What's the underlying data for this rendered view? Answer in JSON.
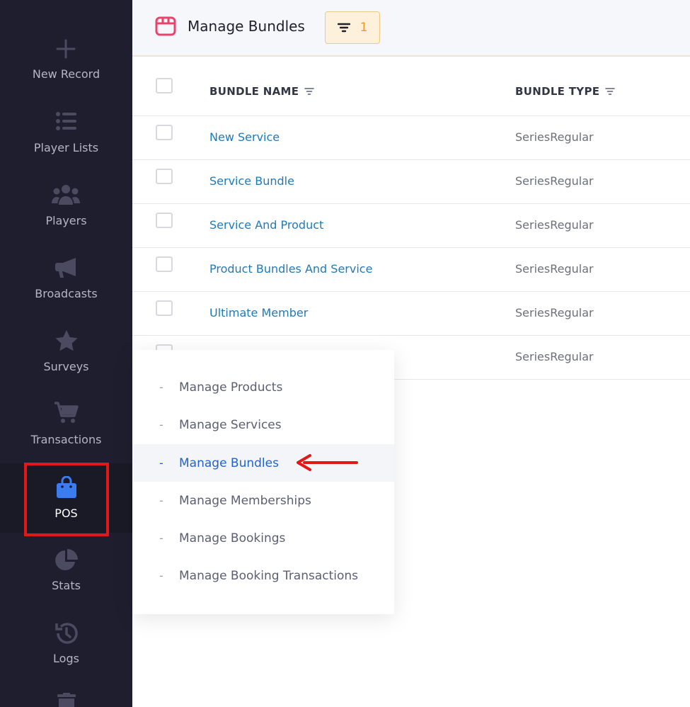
{
  "sidebar": {
    "items": [
      {
        "label": "New Record",
        "icon": "plus-icon"
      },
      {
        "label": "Player Lists",
        "icon": "list-icon"
      },
      {
        "label": "Players",
        "icon": "users-icon"
      },
      {
        "label": "Broadcasts",
        "icon": "megaphone-icon"
      },
      {
        "label": "Surveys",
        "icon": "star-icon"
      },
      {
        "label": "Transactions",
        "icon": "cart-icon"
      },
      {
        "label": "POS",
        "icon": "shopping-bag-icon",
        "active": true
      },
      {
        "label": "Stats",
        "icon": "pie-chart-icon"
      },
      {
        "label": "Logs",
        "icon": "history-icon"
      },
      {
        "label": "",
        "icon": "trash-icon"
      }
    ]
  },
  "header": {
    "title": "Manage Bundles",
    "title_icon": "bundle-box-icon",
    "filter_count": "1"
  },
  "table": {
    "columns": [
      "BUNDLE NAME",
      "BUNDLE TYPE"
    ],
    "rows": [
      {
        "name": "New Service",
        "type": "SeriesRegular"
      },
      {
        "name": "Service Bundle",
        "type": "SeriesRegular"
      },
      {
        "name": "Service And Product",
        "type": "SeriesRegular"
      },
      {
        "name": "Product Bundles And Service",
        "type": "SeriesRegular"
      },
      {
        "name": "Ultimate Member",
        "type": "SeriesRegular"
      },
      {
        "name": "",
        "type": "SeriesRegular"
      }
    ]
  },
  "pos_menu": {
    "items": [
      {
        "label": "Manage Products"
      },
      {
        "label": "Manage Services"
      },
      {
        "label": "Manage Bundles",
        "active": true
      },
      {
        "label": "Manage Memberships"
      },
      {
        "label": "Manage Bookings"
      },
      {
        "label": "Manage Booking Transactions"
      }
    ],
    "dash": "-"
  },
  "colors": {
    "sidebar_bg": "#1f1e2e",
    "accent_blue": "#1e63d6",
    "link_blue": "#1f7ab8",
    "highlight_red": "#e01818",
    "filter_orange": "#f09a1d"
  }
}
